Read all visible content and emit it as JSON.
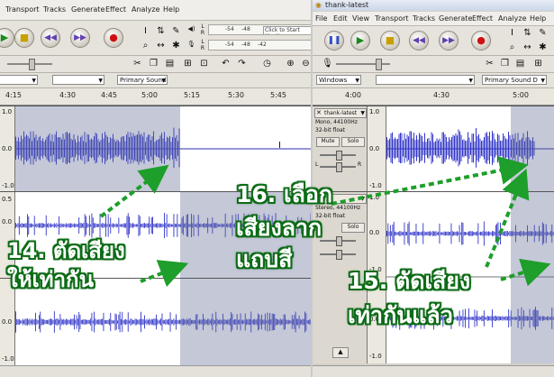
{
  "left_window": {
    "menu": [
      "Transport",
      "Tracks",
      "Generate",
      "Effect",
      "Analyze",
      "Help"
    ],
    "meter_top": {
      "ticks": [
        "-54",
        "-48"
      ],
      "label": "Click to Start Monit"
    },
    "meter_bottom": {
      "ticks": [
        "-54",
        "-48",
        "-42"
      ]
    },
    "device": "Primary Sound D",
    "ruler": [
      "4:15",
      "4:30",
      "4:45",
      "5:00",
      "5:15",
      "5:30",
      "5:45"
    ],
    "y_labels": {
      "top": [
        "1.0",
        "0.0",
        "-1.0"
      ],
      "middle": [
        "0.0",
        "0.5"
      ],
      "bottom": [
        "0.0",
        "-1.0"
      ]
    },
    "meter_letters": [
      "L",
      "R"
    ]
  },
  "right_window": {
    "title": "thank-latest",
    "menu": [
      "File",
      "Edit",
      "View",
      "Transport",
      "Tracks",
      "Generate",
      "Effect",
      "Analyze",
      "Help"
    ],
    "host": "Windows",
    "device": "Primary Sound D",
    "ruler": [
      "4:00",
      "4:30",
      "5:00"
    ],
    "track_info": {
      "name": "thank-latest",
      "format1": "Mono, 44100Hz",
      "format2": "32-bit float",
      "mute": "Mute",
      "solo": "Solo",
      "format3": "Stereo, 44100Hz",
      "format4": "32-bit float",
      "solo2": "Solo"
    },
    "y_labels": {
      "top": [
        "1.0",
        "0.0",
        "-1.0"
      ],
      "middle": [
        "1.0",
        "0.0",
        "-1.0"
      ],
      "bottom": [
        "1.0",
        "0.0",
        "-1.0"
      ]
    },
    "meter_letters": [
      "L",
      "R"
    ]
  },
  "annotations": {
    "step14_line1": "14. ตัดเสียง",
    "step14_line2": "ให้เท่ากัน",
    "step16_line1": "16. เลือก",
    "step16_line2": "เสียงลาก",
    "step16_line3": "แถบสี",
    "step15_line1": "15. ตัดเสียง",
    "step15_line2": "เท่ากันแล้ว"
  },
  "colors": {
    "waveform": "#3236c8",
    "selection": "#6e7396",
    "arrow": "#1e9e2a",
    "caption_outline": "#0c6b16"
  }
}
